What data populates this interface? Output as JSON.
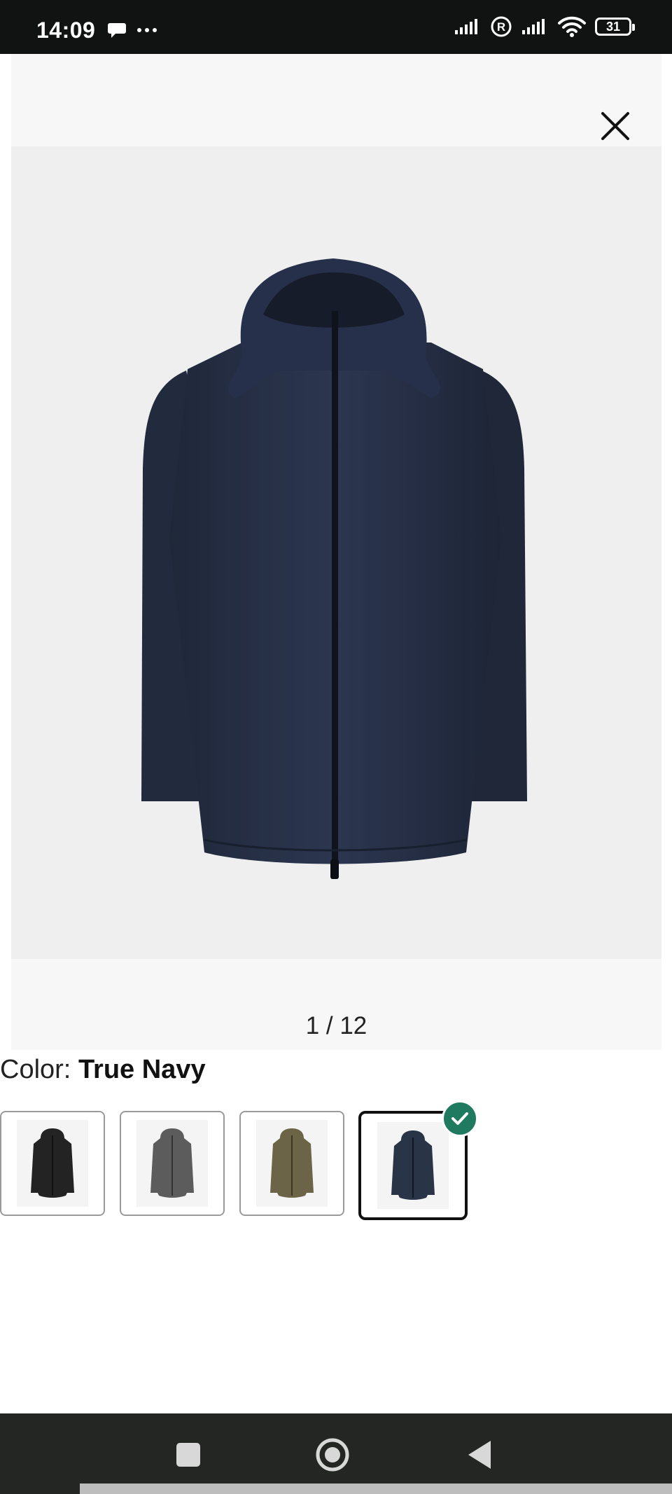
{
  "status_bar": {
    "time": "14:09",
    "battery_level": "31",
    "icons": [
      "chat-bubble-icon",
      "more-dots-icon",
      "signal-icon",
      "roaming-r-icon",
      "signal-icon",
      "wifi-icon",
      "battery-icon"
    ]
  },
  "viewer": {
    "counter": "1 / 12",
    "close_icon": "close-icon",
    "product_image": "navy-hooded-jacket"
  },
  "color": {
    "label": "Color:",
    "selected_name": "True Navy",
    "options": [
      {
        "name": "black",
        "hex": "#232323"
      },
      {
        "name": "grey",
        "hex": "#5c5c5c"
      },
      {
        "name": "olive",
        "hex": "#6b6446"
      },
      {
        "name": "navy",
        "hex": "#2a3447"
      }
    ],
    "selected_index": 3,
    "accent": "#1f7a5f"
  },
  "nav_bar": {
    "buttons": [
      "recent-apps-icon",
      "home-icon",
      "back-icon"
    ]
  }
}
